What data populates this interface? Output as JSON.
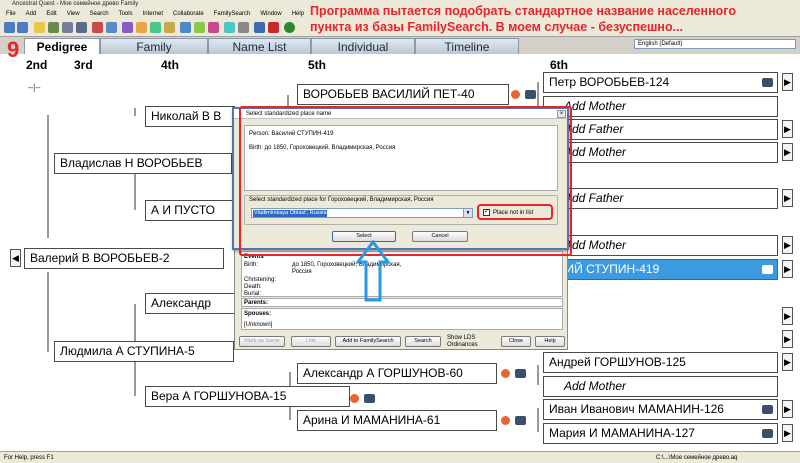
{
  "app": {
    "title": "Ancestral Quest - Мое семейное древо Family"
  },
  "menu": [
    "File",
    "Add",
    "Edit",
    "View",
    "Search",
    "Tools",
    "Internet",
    "Collaborate",
    "FamilySearch",
    "Window",
    "Help"
  ],
  "annotation": "Программа пытается подобрать стандартное название населенного пункта из базы FamilySearch. В моем случае - безуспешно...",
  "tabs": {
    "pedigree_number": "9",
    "items": [
      "Pedigree",
      "Family",
      "Name List",
      "Individual",
      "Timeline"
    ]
  },
  "language_select": "English (Default)",
  "generations": {
    "g2": "2nd",
    "g3": "3rd",
    "g4": "4th",
    "g5": "5th",
    "g6": "6th"
  },
  "pedigree": {
    "root": "Валерий В ВОРОБЬЕВ-2",
    "father": "Владислав Н ВОРОБЬЕВ",
    "mother": "Людмила А СТУПИНА-5",
    "ff": "Николай В В",
    "fm": "А И ПУСТО",
    "mf": "Александр",
    "mm": "Вера А ГОРШУНОВА-15",
    "fff": "ВОРОБЬЕВ ВАСИЛИЙ ПЕТ-40",
    "mmf": "Александр А ГОРШУНОВ-60",
    "mmm": "Арина И МАМАНИНА-61",
    "g6": {
      "n1": "Петр ВОРОБЬЕВ-124",
      "add_mother_1": "Add Mother",
      "add_father_1": "Add Father",
      "add_mother_2": "Add Mother",
      "add_father_2": "Add Father",
      "add_mother_3": "Add Mother",
      "selected": "ИЛИЙ СТУПИН-419",
      "n_gorshunov": "Андрей ГОРШУНОВ-125",
      "add_mother_4": "Add Mother",
      "n_mamanin": "Иван Иванович МАМАНИН-126",
      "n_mamanina": "Мария И МАМАНИНА-127"
    }
  },
  "dialog": {
    "title": "Select standardized place name",
    "person_label": "Person: Василий СТУПИН-419",
    "birth_line": "Birth: до 1850, Гороховецкий, Владимирская, Россия",
    "group_label": "Select standardized place for Гороховецкий, Владимирская, Россия",
    "combo_value": "Vladimirskaya Oblast', Russia",
    "checkbox_label": "Place not in list",
    "select_button": "Select",
    "cancel_button": "Cancel"
  },
  "person_panel": {
    "events_label": "Events",
    "birth_label": "Birth:",
    "birth_value": "до 1850, Гороховецкий, Владимирская, Россия",
    "christening_label": "Christening:",
    "death_label": "Death:",
    "burial_label": "Burial:",
    "parents_label": "Parents:",
    "spouses_label": "Spouses:",
    "unknown": "[Unknown]",
    "buttons": {
      "mark_as_same": "Mark as Same",
      "link": "Link",
      "add_to_fs": "Add to FamilySearch",
      "search": "Search",
      "show_lds": "Show LDS Ordinances",
      "close": "Close",
      "help": "Help"
    }
  },
  "status": {
    "left": "For Help, press F1",
    "right": "C:\\...\\Мое семейное древо.aq"
  },
  "colors": {
    "accent_red": "#e8242c",
    "selected_node": "#3c9ae0",
    "dialog_border": "#5573b0"
  }
}
